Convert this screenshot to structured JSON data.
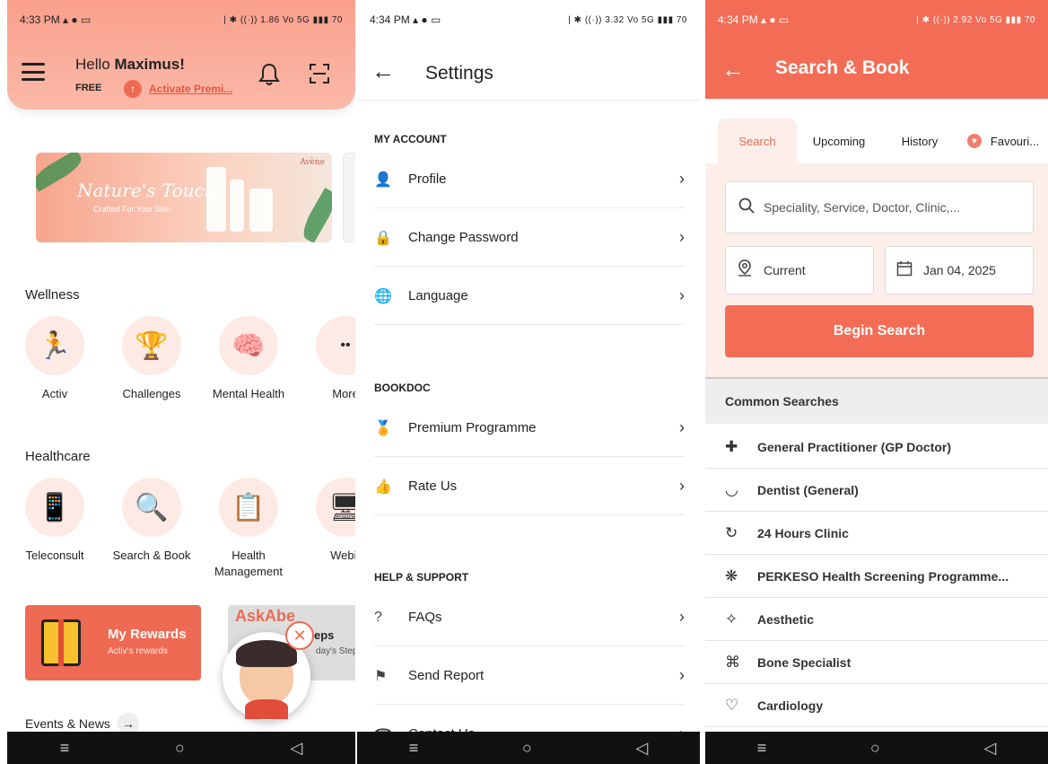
{
  "screen1": {
    "status": {
      "time": "4:33 PM",
      "icons": "▴ ● ▭",
      "right": "| ✱ ((·)) 1.86 Vo 5G ▮▮▮ 70"
    },
    "header": {
      "greeting_prefix": "Hello",
      "user_name": "Maximus!",
      "plan": "FREE",
      "premium_link": "Activate Premi...",
      "bell_icon": "bell-icon",
      "scan_icon": "scan-icon"
    },
    "banner": {
      "brand": "Avène",
      "title": "Nature's Touch",
      "subtitle": "Crafted For Your Skin"
    },
    "wellness": {
      "title": "Wellness",
      "items": [
        {
          "label": "Activ",
          "icon": "🏃"
        },
        {
          "label": "Challenges",
          "icon": "🏆"
        },
        {
          "label": "Mental Health",
          "icon": "🧠"
        },
        {
          "label": "More",
          "icon": "••"
        }
      ]
    },
    "healthcare": {
      "title": "Healthcare",
      "items": [
        {
          "label": "Teleconsult",
          "icon": "📱"
        },
        {
          "label": "Search & Book",
          "icon": "🔍"
        },
        {
          "label": "Health Management",
          "icon": "📋"
        },
        {
          "label": "Webir",
          "icon": "🖥"
        }
      ]
    },
    "rewards": {
      "title": "My Rewards",
      "subtitle": "Activ's rewards"
    },
    "steps": {
      "brand": "AskAbe",
      "title": "eps",
      "subtitle": "day's Step"
    },
    "events": {
      "label": "Events & News"
    },
    "nav": [
      "≡",
      "○",
      "◁"
    ]
  },
  "screen2": {
    "status": {
      "time": "4:34 PM",
      "icons": "▴ ● ▭",
      "right": "| ✱ ((·)) 3.32 Vo 5G ▮▮▮ 70"
    },
    "title": "Settings",
    "groups": [
      {
        "title": "MY ACCOUNT",
        "items": [
          {
            "label": "Profile",
            "icon": "👤"
          },
          {
            "label": "Change Password",
            "icon": "🔒"
          },
          {
            "label": "Language",
            "icon": "🌐"
          }
        ]
      },
      {
        "title": "BOOKDOC",
        "items": [
          {
            "label": "Premium Programme",
            "icon": "🏅"
          },
          {
            "label": "Rate Us",
            "icon": "👍"
          }
        ]
      },
      {
        "title": "HELP & SUPPORT",
        "items": [
          {
            "label": "FAQs",
            "icon": "?"
          },
          {
            "label": "Send Report",
            "icon": "⚑"
          },
          {
            "label": "Contact Us",
            "icon": "☎"
          }
        ]
      }
    ],
    "nav": [
      "≡",
      "○",
      "◁"
    ]
  },
  "screen3": {
    "status": {
      "time": "4:34 PM",
      "icons": "▴ ● ▭",
      "right": "| ✱ ((·)) 2.92 Vo 5G ▮▮▮ 70"
    },
    "title": "Search & Book",
    "tabs": [
      {
        "label": "Search"
      },
      {
        "label": "Upcoming"
      },
      {
        "label": "History"
      },
      {
        "label": "Favouri..."
      }
    ],
    "search_placeholder": "Speciality, Service, Doctor, Clinic,...",
    "location": "Current",
    "date": "Jan 04, 2025",
    "begin_button": "Begin Search",
    "common_title": "Common Searches",
    "common_items": [
      {
        "label": "General Practitioner (GP Doctor)",
        "icon": "✚"
      },
      {
        "label": "Dentist (General)",
        "icon": "◡"
      },
      {
        "label": "24 Hours Clinic",
        "icon": "↻"
      },
      {
        "label": "PERKESO Health Screening Programme...",
        "icon": "❋"
      },
      {
        "label": "Aesthetic",
        "icon": "✧"
      },
      {
        "label": "Bone Specialist",
        "icon": "⌘"
      },
      {
        "label": "Cardiology",
        "icon": "♡"
      }
    ],
    "nav": [
      "≡",
      "○",
      "◁"
    ]
  }
}
